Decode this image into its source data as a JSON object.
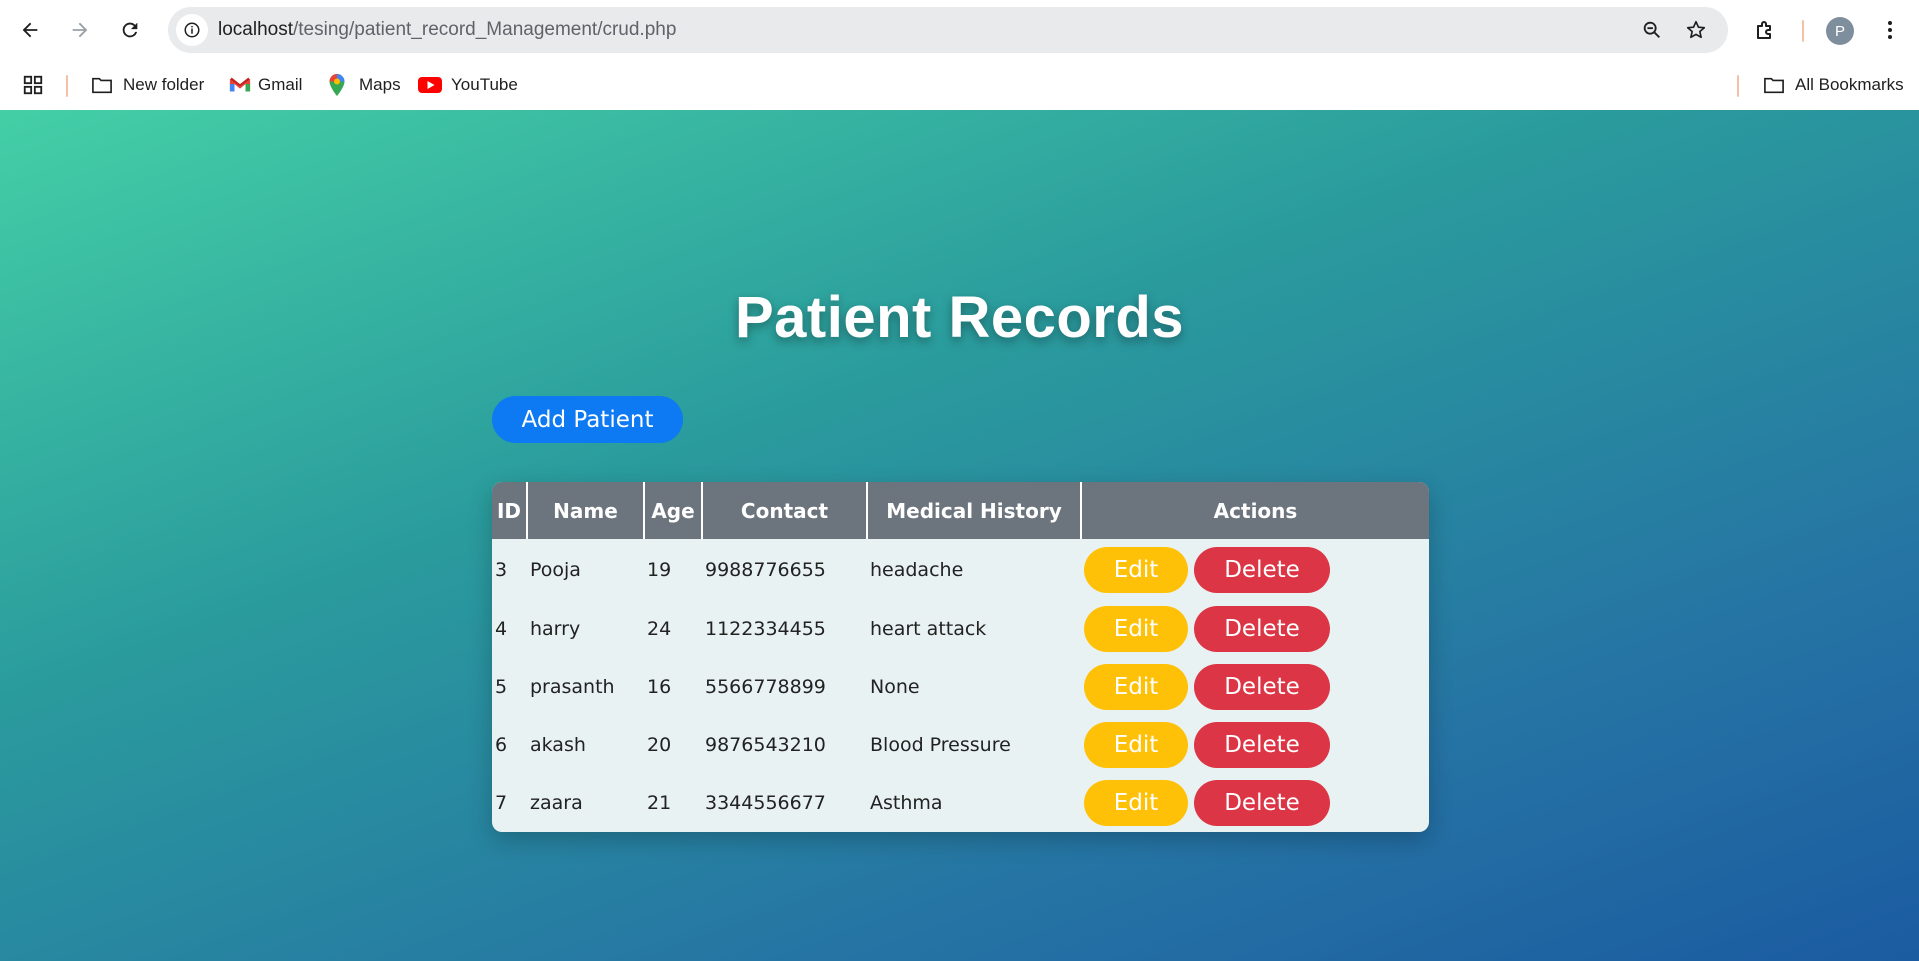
{
  "browser": {
    "url_host": "localhost",
    "url_path": "/tesing/patient_record_Management/crud.php",
    "profile_initial": "P",
    "bookmarks": [
      {
        "label": "New folder",
        "icon": "folder-icon"
      },
      {
        "label": "Gmail",
        "icon": "gmail-icon"
      },
      {
        "label": "Maps",
        "icon": "maps-icon"
      },
      {
        "label": "YouTube",
        "icon": "youtube-icon"
      }
    ],
    "all_bookmarks_label": "All Bookmarks"
  },
  "page": {
    "title": "Patient Records",
    "add_button_label": "Add Patient",
    "background_colors": [
      "#44cfa6",
      "#1b5ba1"
    ]
  },
  "table": {
    "headers": [
      "ID",
      "Name",
      "Age",
      "Contact",
      "Medical History",
      "Actions"
    ],
    "rows": [
      {
        "id": "3",
        "name": "Pooja",
        "age": "19",
        "contact": "9988776655",
        "history": "headache"
      },
      {
        "id": "4",
        "name": "harry",
        "age": "24",
        "contact": "1122334455",
        "history": "heart attack"
      },
      {
        "id": "5",
        "name": "prasanth",
        "age": "16",
        "contact": "5566778899",
        "history": "None"
      },
      {
        "id": "6",
        "name": "akash",
        "age": "20",
        "contact": "9876543210",
        "history": "Blood Pressure"
      },
      {
        "id": "7",
        "name": "zaara",
        "age": "21",
        "contact": "3344556677",
        "history": "Asthma"
      }
    ],
    "edit_label": "Edit",
    "delete_label": "Delete",
    "colors": {
      "header": "#6c757d",
      "edit": "#ffc107",
      "delete": "#dc3545",
      "add": "#0d79f2"
    }
  }
}
